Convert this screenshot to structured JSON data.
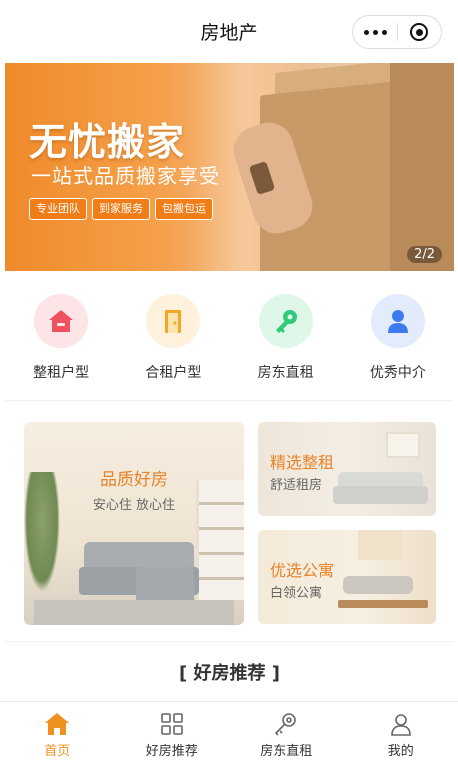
{
  "header": {
    "title": "房地产"
  },
  "banner": {
    "headline": "无忧搬家",
    "subline": "一站式品质搬家享受",
    "tags": [
      "专业团队",
      "到家服务",
      "包搬包运"
    ],
    "pager": "2/2"
  },
  "categories": [
    {
      "label": "整租户型",
      "icon": "house-icon",
      "color": "#f0505f",
      "bg": "#fde4e6"
    },
    {
      "label": "合租户型",
      "icon": "door-icon",
      "color": "#f5a623",
      "bg": "#fef2dc"
    },
    {
      "label": "房东直租",
      "icon": "key-icon",
      "color": "#2fcb79",
      "bg": "#dff7e9"
    },
    {
      "label": "优秀中介",
      "icon": "person-icon",
      "color": "#3d7cf0",
      "bg": "#e3ecfc"
    }
  ],
  "promos": {
    "big": {
      "title": "品质好房",
      "sub": "安心住 放心住"
    },
    "small": [
      {
        "title": "精选整租",
        "sub": "舒适租房"
      },
      {
        "title": "优选公寓",
        "sub": "白领公寓"
      }
    ]
  },
  "recommend": {
    "title": "[ 好房推荐 ]"
  },
  "tabbar": [
    {
      "label": "首页",
      "icon": "home-icon",
      "active": true
    },
    {
      "label": "好房推荐",
      "icon": "grid-icon",
      "active": false
    },
    {
      "label": "房东直租",
      "icon": "key-outline-icon",
      "active": false
    },
    {
      "label": "我的",
      "icon": "user-icon",
      "active": false
    }
  ],
  "colors": {
    "accent": "#f0901e",
    "promo_title": "#e8832a"
  }
}
